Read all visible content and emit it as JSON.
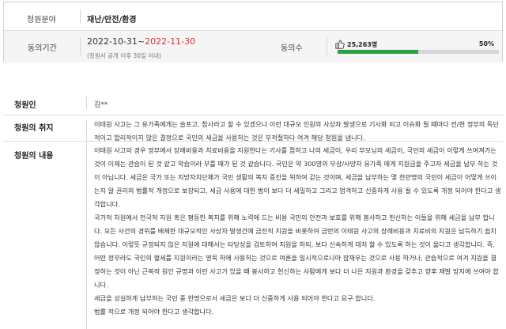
{
  "petition": {
    "category_label": "청원분야",
    "category_value": "재난/안전/환경",
    "period_label": "동의기간",
    "period_start": "2022-10-31~",
    "period_end": "2022-11-30",
    "period_note": "(청원서 공개 이후 30일 이내)",
    "agree_label": "동의수",
    "agree_count": "25,263명",
    "agree_percent_text": "50%",
    "agree_fraction": 0.5,
    "bar_color": "#2f9e44",
    "thumb_icon": "thumbs-up-icon",
    "author_label": "청원인",
    "author_value": "김**",
    "purpose_label": "청원의 취지",
    "purpose_text": "이태원 사고는 그 유가족에게는 슬프고, 참사라고 할 수 있겠으나 이런 대규모 인원의 사상자 발생으로 기사화 되고 이슈화 될 때마다 전/현 정부의 독단적이고 합리적이지 않은 결정으로 국민의 세금을 사용하는 것은 부적절하다 여겨 해당 청원을 냅니다.",
    "content_label": "청원의 내용",
    "content_paragraphs": [
      "이태원 사고의 경우 정부에서 장례비용과 치료비용을 지원한다는 기사를 접하고 나의 세금이, 우리 부모님의 세금이, 국민의 세금이 이렇게 쓰여져가는 것이 이제는 관습이 된 것 같고 악습이라 부를 때가 된 것 같습니다. 국민은 약 300명의 부상/사망자 유가족 에게 지원금을 주고자 세금을 납부 하는 것이 아닙니다. 세금은 국가 또는 지방자치단체가 국민 생활의 복지 증진을 위하여 걷는 것이며, 세금을 납부하는 몇 천만명의 국민이 세금이 어떻게 쓰이는지 알 권리의 법률적 개정으로 보장되고, 세금 사용에 대한 법이 보다 더 세밀하고 그리고 엄격하고 신중하게 사용 될 수 있도록 개정 되어야 한다고 생각합니다.",
      "국가적 차원에서 전국적 지원 혹은 평등한 복지를 위해 노력에 드는 비용 국민의 안전과 보호를 위해 봉사하고 헌신하는 이들을 위해 세금을 납부 합니다. 모든 사건의 경위를 배제한 대규모적인 사상자 발생건에 금전적 지원을 비롯하여 금번의 이태원 사고의 장례비용과 치료비의 지원은 납득하기 쉽지 않습니다. 이렇듯 규정되지 않은 지원에 대해서는 타당성을 검토하여 지원을 하되, 보다 신속하게 대처 할 수 있도록 하는 것이 옳다고 생각합니다. 즉, 어떤 정부라도 국민의 혈세를 지원이라는 명목 하에 사용하는 것으로 여론을 일시적으로나마 잠재우는 것으로 사용 하거나, 관습적으로 여겨 지원을 결정하는 것이 아닌 근복적 원인 규명과 이런 사고가 있을 때 봉사하고 헌신하는 사람에게 보다 더 나은 지원과 환경을 갖추고 향후 재발 방지에 쓰여야 합니다.",
      "세금을 성실하게 납부하는 국민 중 한명으로서 세금은 보다 더 신중하게 사용 되어야 한다고 요구 합니다.",
      "법률 적으로 개정 되어야 한다고 생각합니다."
    ]
  }
}
